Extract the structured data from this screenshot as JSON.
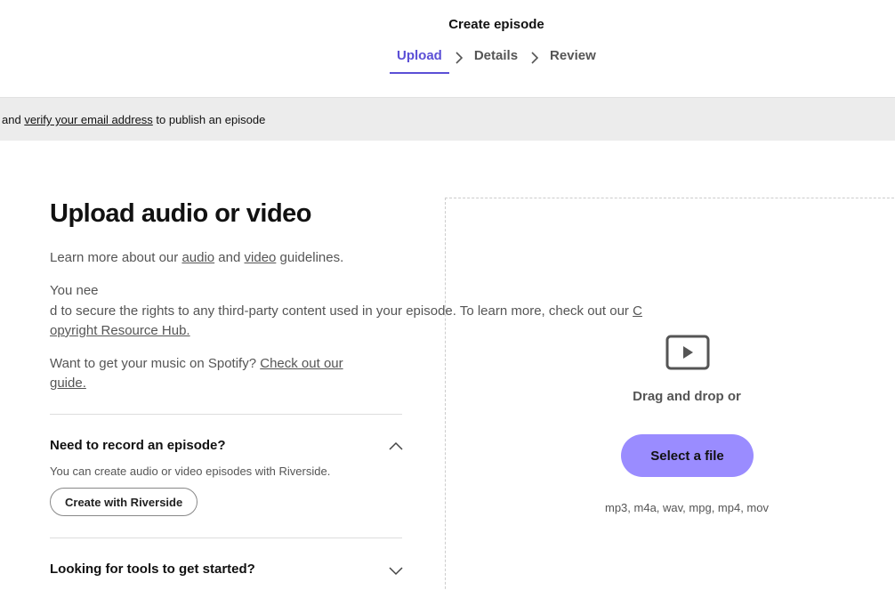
{
  "header": {
    "title": "Create episode",
    "steps": [
      {
        "label": "Upload",
        "active": true
      },
      {
        "label": "Details",
        "active": false
      },
      {
        "label": "Review",
        "active": false
      }
    ]
  },
  "banner": {
    "prefix": "and ",
    "link": "verify your email address",
    "suffix": " to publish an episode"
  },
  "main": {
    "title": "Upload audio or video",
    "guidelines": {
      "prefix": "Learn more about our ",
      "audio_link": "audio",
      "mid": " and ",
      "video_link": "video",
      "suffix": " guidelines."
    },
    "rights": {
      "line1": "You nee",
      "line2_text": "d to secure the rights to any third-party content used in your episode. To learn more, check out our ",
      "line2_link": "C",
      "line3_link": "opyright Resource Hub."
    },
    "spotify": {
      "prefix": "Want to get your music on Spotify? ",
      "link1": "Check out our",
      "link2": "guide."
    },
    "accordion": [
      {
        "title": "Need to record an episode?",
        "expanded": true,
        "description": "You can create audio or video episodes with Riverside.",
        "button": "Create with Riverside",
        "toggle_icon": "chevron-up-icon"
      },
      {
        "title": "Looking for tools to get started?",
        "expanded": false,
        "toggle_icon": "chevron-down-icon"
      }
    ]
  },
  "dropzone": {
    "icon": "video-play-icon",
    "drag_text": "Drag and drop or",
    "select_button": "Select a file",
    "formats": "mp3, m4a, wav, mpg, mp4, mov"
  },
  "colors": {
    "accent": "#5b4fd6",
    "select_button": "#9a8cff",
    "banner_bg": "#ececec"
  }
}
